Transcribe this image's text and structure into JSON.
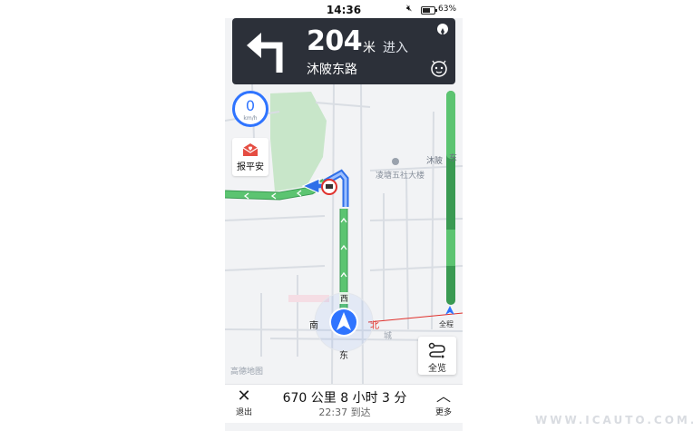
{
  "status_bar": {
    "time": "14:36",
    "battery": "63%",
    "mute_icon": "mute-icon"
  },
  "guidance": {
    "distance": "204",
    "unit": "米",
    "action": "进入",
    "road": "沐陂东路",
    "turn_icon": "turn-left-icon"
  },
  "map": {
    "speed_value": "0",
    "speed_unit": "km/h",
    "report_label": "报平安",
    "poi_label": "凌塘五社大楼",
    "road_label_right": "沐陂",
    "road_label_right2": "东",
    "route_label": "西",
    "compass": {
      "south": "南",
      "east": "东",
      "north": "北"
    },
    "place_label": "城",
    "all_route_label": "全程",
    "overview_label": "全览",
    "brand": "高德地图"
  },
  "bottom_bar": {
    "exit_label": "退出",
    "summary": "670 公里  8 小时 3 分",
    "eta": "22:37 到达",
    "more_label": "更多"
  },
  "watermark": "WWW.ICAUTO.COM.CN",
  "colors": {
    "route_green": "#4dbb66",
    "route_blue": "#3e7bf3",
    "card_bg": "#2c3039",
    "accent": "#2f74ff"
  }
}
